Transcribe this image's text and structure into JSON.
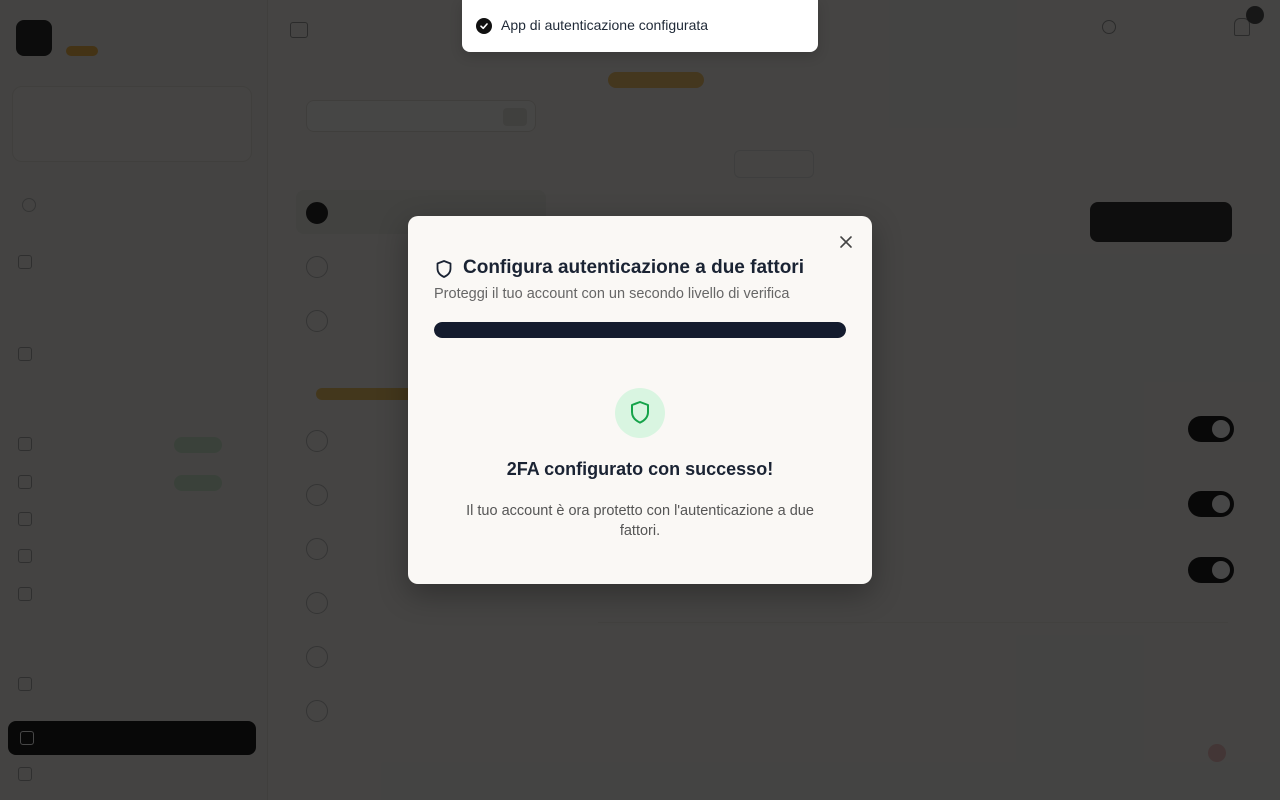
{
  "toast": {
    "message": "App di autenticazione configurata",
    "icon": "check-circle-icon"
  },
  "modal": {
    "title": "Configura autenticazione a due fattori",
    "subtitle": "Proteggi il tuo account con un secondo livello di verifica",
    "title_icon": "shield-icon",
    "close_icon": "close-icon",
    "progress_percent": 100,
    "success_icon": "shield-icon",
    "success_title": "2FA configurato con successo!",
    "success_description": "Il tuo account è ora protetto con l'autenticazione a due fattori.",
    "colors": {
      "progress": "#141c2e",
      "success_bg": "#d9f5e1",
      "success_icon": "#16a34a"
    }
  }
}
